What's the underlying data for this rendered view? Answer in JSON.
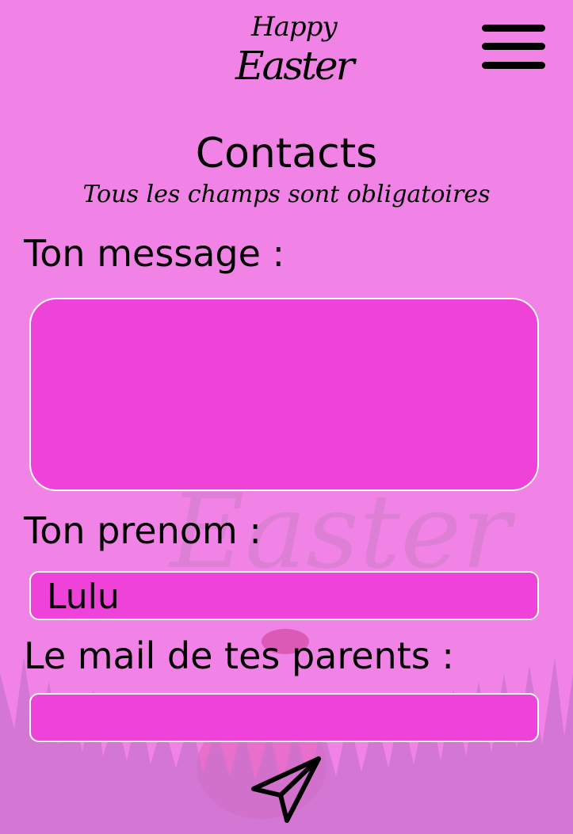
{
  "header": {
    "logo": {
      "line1": "Happy",
      "line2": "Easter"
    },
    "menu_icon": "hamburger-menu-icon"
  },
  "page": {
    "title": "Contacts",
    "subtitle": "Tous les champs sont obligatoires"
  },
  "form": {
    "message": {
      "label": "Ton message  :",
      "value": ""
    },
    "first_name": {
      "label": "Ton prenom :",
      "value": "Lulu"
    },
    "parent_email": {
      "label": "Le mail de tes parents :",
      "value": ""
    },
    "submit_icon": "paper-plane-send-icon"
  },
  "background": {
    "watermark_text": "Easter",
    "decorations": [
      "grass-illustration",
      "easter-egg-illustration"
    ]
  },
  "colors": {
    "background": "#f283e6",
    "field_fill": "#ef42d9",
    "field_border": "#ffffff",
    "text": "#000000"
  }
}
